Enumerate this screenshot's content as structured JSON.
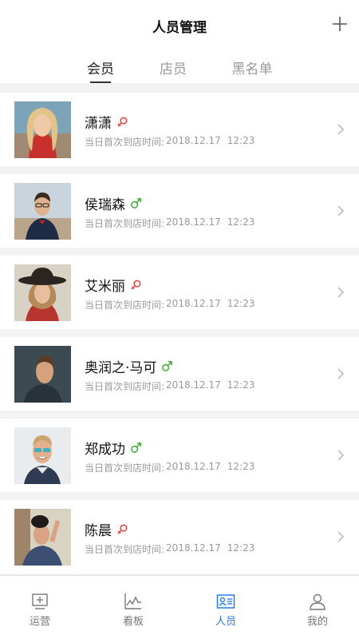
{
  "header": {
    "title": "人员管理",
    "add_icon": "plus-icon"
  },
  "tabs": [
    {
      "label": "会员",
      "active": true
    },
    {
      "label": "店员",
      "active": false
    },
    {
      "label": "黑名单",
      "active": false
    }
  ],
  "colors": {
    "accent": "#2a7bea",
    "female": "#e8403d",
    "male": "#3aaa35"
  },
  "members": [
    {
      "name": "潇潇",
      "gender": "female",
      "visit_label": "当日首次到店时间:",
      "date": "2018.12.17",
      "time": "12:23"
    },
    {
      "name": "侯瑞森",
      "gender": "male",
      "visit_label": "当日首次到店时间:",
      "date": "2018.12.17",
      "time": "12:23"
    },
    {
      "name": "艾米丽",
      "gender": "female",
      "visit_label": "当日首次到店时间:",
      "date": "2018.12.17",
      "time": "12:23"
    },
    {
      "name": "奥润之·马可",
      "gender": "male",
      "visit_label": "当日首次到店时间:",
      "date": "2018.12.17",
      "time": "12:23"
    },
    {
      "name": "郑成功",
      "gender": "male",
      "visit_label": "当日首次到店时间:",
      "date": "2018.12.17",
      "time": "12:23"
    },
    {
      "name": "陈晨",
      "gender": "female",
      "visit_label": "当日首次到店时间:",
      "date": "2018.12.17",
      "time": "12:23"
    }
  ],
  "tabbar": [
    {
      "label": "运营",
      "icon": "operations-icon",
      "active": false
    },
    {
      "label": "看板",
      "icon": "dashboard-chart-icon",
      "active": false
    },
    {
      "label": "人员",
      "icon": "people-card-icon",
      "active": true
    },
    {
      "label": "我的",
      "icon": "profile-icon",
      "active": false
    }
  ]
}
